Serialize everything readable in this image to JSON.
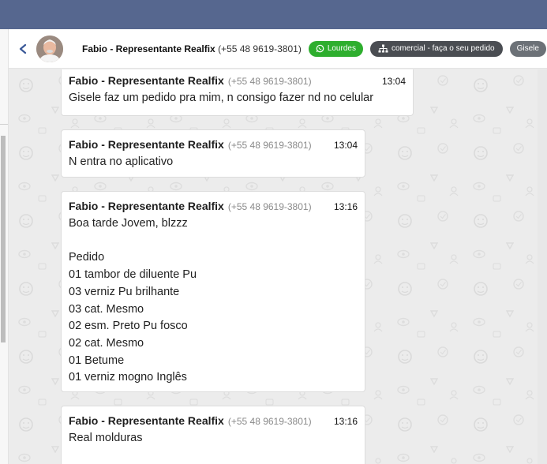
{
  "header": {
    "contact_name": "Fabio - Representante Realfix",
    "contact_phone": "(+55 48 9619-3801)",
    "tags": [
      {
        "label": "Lourdes",
        "color": "#2eae2e",
        "icon": "whatsapp-icon"
      },
      {
        "label": "comercial - faça o seu pedido",
        "color": "#4a4d52",
        "icon": "sitemap-icon"
      },
      {
        "label": "Gisele",
        "color": "#6c7177"
      }
    ]
  },
  "messages": [
    {
      "sender": "Fabio - Representante Realfix",
      "phone": "(+55 48 9619-3801)",
      "time": "13:04",
      "text": "Gisele faz um pedido pra mim, n consigo fazer nd no celular"
    },
    {
      "sender": "Fabio - Representante Realfix",
      "phone": "(+55 48 9619-3801)",
      "time": "13:04",
      "text": "N entra no aplicativo"
    },
    {
      "sender": "Fabio - Representante Realfix",
      "phone": "(+55 48 9619-3801)",
      "time": "13:16",
      "text": "Boa tarde Jovem, blzzz\n\nPedido\n01 tambor de diluente Pu\n03 verniz Pu brilhante\n03 cat. Mesmo\n02 esm. Preto Pu fosco\n02 cat. Mesmo\n01 Betume\n01 verniz mogno Inglês"
    },
    {
      "sender": "Fabio - Representante Realfix",
      "phone": "(+55 48 9619-3801)",
      "time": "13:16",
      "text": "Real molduras"
    }
  ],
  "colors": {
    "topbar": "#56678f",
    "chat_bg": "#ececec",
    "bubble": "#ffffff"
  }
}
